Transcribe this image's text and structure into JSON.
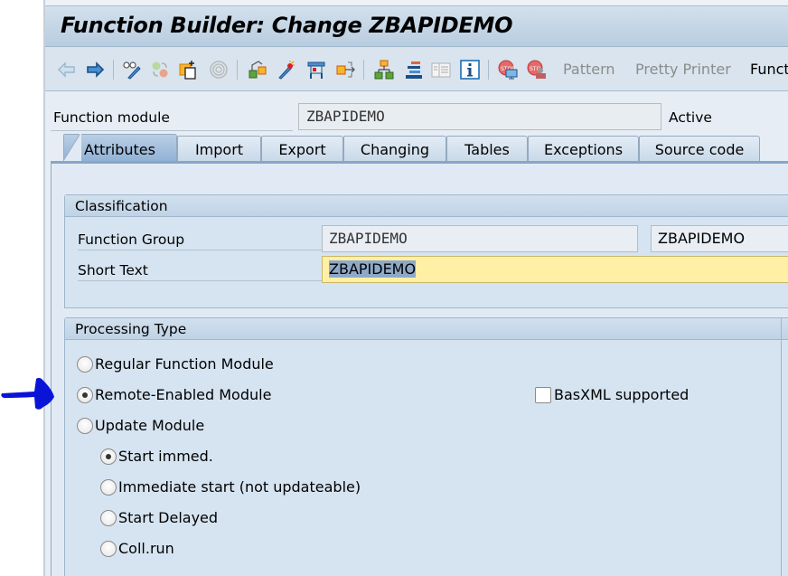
{
  "window": {
    "title": "Function Builder: Change ZBAPIDEMO"
  },
  "toolbar": {
    "icons": [
      {
        "name": "back-icon",
        "enabled": false
      },
      {
        "name": "forward-icon",
        "enabled": true
      },
      {
        "name": "display-change-icon",
        "enabled": true
      },
      {
        "name": "active-inactive-icon",
        "enabled": false
      },
      {
        "name": "other-object-icon",
        "enabled": true
      },
      {
        "name": "check-icon",
        "enabled": false
      },
      {
        "name": "activate-icon",
        "enabled": true
      },
      {
        "name": "test-wand-icon",
        "enabled": true
      },
      {
        "name": "where-used-icon",
        "enabled": true
      },
      {
        "name": "export-icon",
        "enabled": true
      },
      {
        "name": "object-list-icon",
        "enabled": true
      },
      {
        "name": "navigation-stack-icon",
        "enabled": true
      },
      {
        "name": "display-object-list-icon",
        "enabled": false
      },
      {
        "name": "info-icon",
        "enabled": true
      },
      {
        "name": "set-breakpoint-icon",
        "enabled": true
      },
      {
        "name": "session-breakpoint-icon",
        "enabled": true
      }
    ],
    "pattern_label": "Pattern",
    "pretty_printer_label": "Pretty Printer",
    "function_label": "Funct"
  },
  "header": {
    "function_module_label": "Function module",
    "function_module_value": "ZBAPIDEMO",
    "status": "Active"
  },
  "tabs": [
    {
      "label": "Attributes",
      "active": true
    },
    {
      "label": "Import",
      "active": false
    },
    {
      "label": "Export",
      "active": false
    },
    {
      "label": "Changing",
      "active": false
    },
    {
      "label": "Tables",
      "active": false
    },
    {
      "label": "Exceptions",
      "active": false
    },
    {
      "label": "Source code",
      "active": false
    }
  ],
  "classification": {
    "title": "Classification",
    "function_group_label": "Function Group",
    "function_group_value": "ZBAPIDEMO",
    "function_group_text": "ZBAPIDEMO",
    "short_text_label": "Short Text",
    "short_text_value": "ZBAPIDEMO"
  },
  "processing_type": {
    "title": "Processing Type",
    "options": [
      {
        "label": "Regular Function Module",
        "selected": false
      },
      {
        "label": "Remote-Enabled Module",
        "selected": true
      },
      {
        "label": "Update Module",
        "selected": false
      }
    ],
    "update_options": [
      {
        "label": "Start immed.",
        "selected": true
      },
      {
        "label": "Immediate start (not updateable)",
        "selected": false
      },
      {
        "label": "Start Delayed",
        "selected": false
      },
      {
        "label": "Coll.run",
        "selected": false
      }
    ],
    "basxml_label": "BasXML supported",
    "basxml_checked": false
  },
  "annotation": {
    "arrow_color": "#0a14d6",
    "points_to": "Remote-Enabled Module"
  }
}
